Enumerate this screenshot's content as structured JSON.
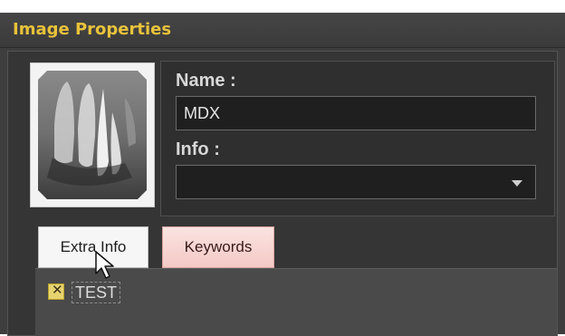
{
  "window": {
    "title": "Image Properties"
  },
  "fields": {
    "name_label": "Name :",
    "name_value": "MDX",
    "info_label": "Info :",
    "info_value": ""
  },
  "tabs": [
    {
      "label": "Extra Info",
      "active": false
    },
    {
      "label": "Keywords",
      "active": true
    }
  ],
  "keywords": [
    {
      "label": "TEST",
      "checked": true
    }
  ],
  "icons": {
    "dropdown": "chevron-down-icon",
    "cursor": "mouse-cursor-icon"
  },
  "colors": {
    "title": "#e8c23a",
    "panel_bg": "#353535",
    "tab_active_bg": "#f4c9c6"
  }
}
